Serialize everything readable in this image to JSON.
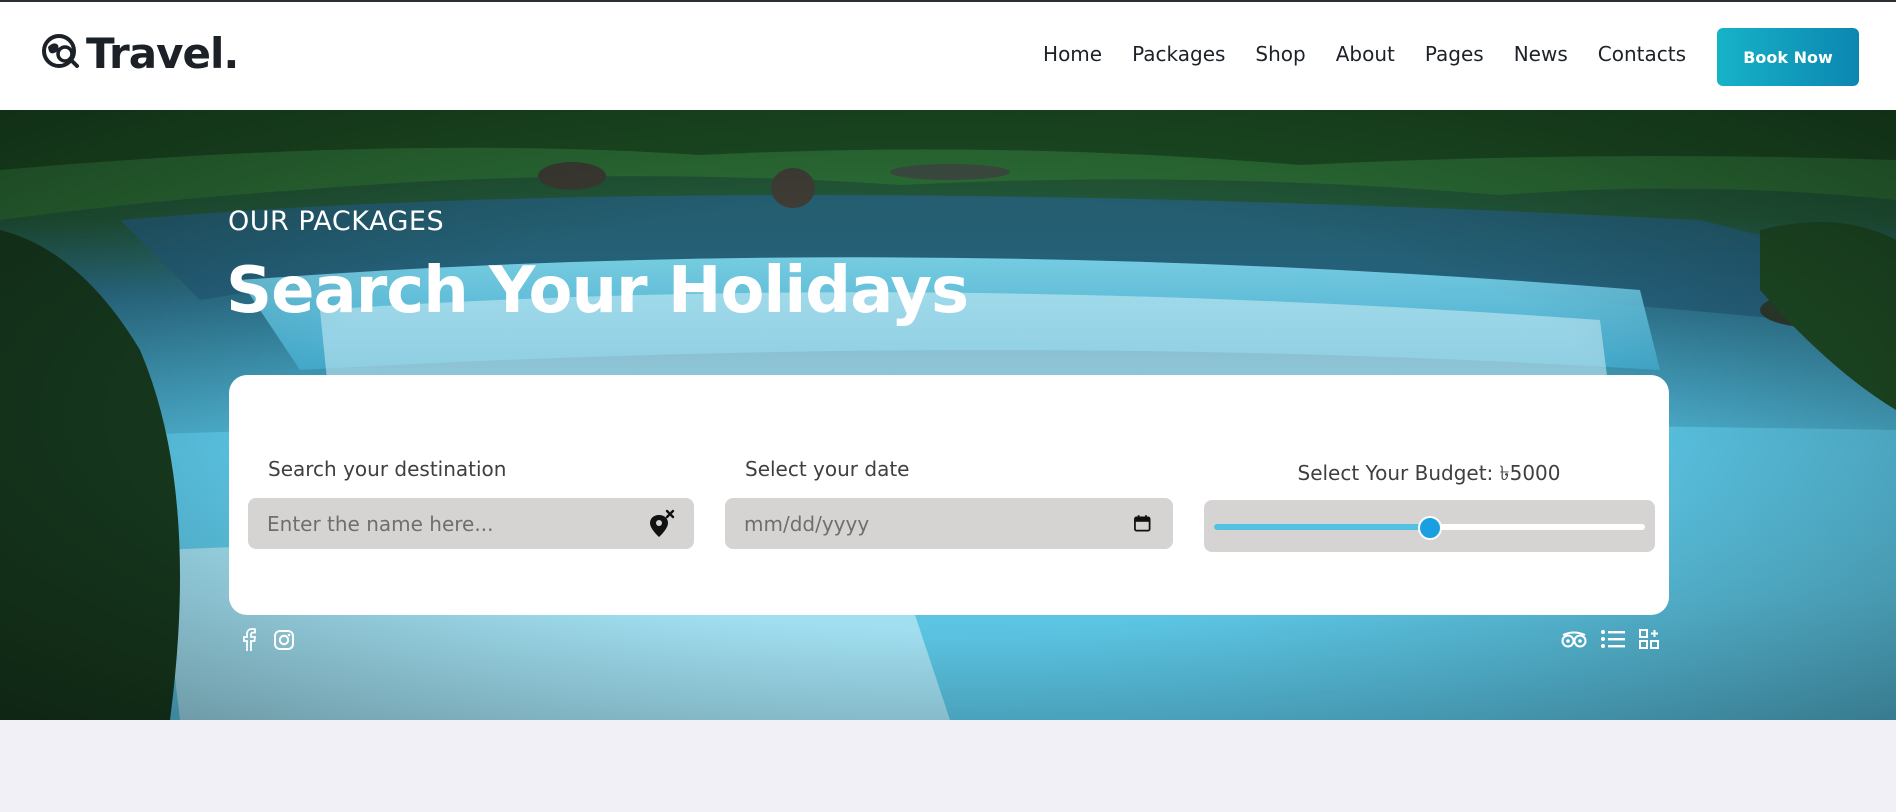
{
  "brand": {
    "name": "Travel."
  },
  "nav": {
    "items": [
      "Home",
      "Packages",
      "Shop",
      "About",
      "Pages",
      "News",
      "Contacts"
    ],
    "cta_label": "Book Now"
  },
  "hero": {
    "subtitle": "OUR PACKAGES",
    "title": "Search Your Holidays"
  },
  "search": {
    "destination": {
      "label": "Search your destination",
      "placeholder": "Enter the name here..."
    },
    "date": {
      "label": "Select your date",
      "placeholder": "mm/dd/yyyy"
    },
    "budget": {
      "label": "Select Your Budget: ৳5000",
      "value_fraction": 0.5
    }
  },
  "icons": {
    "left": [
      "facebook-icon",
      "instagram-icon"
    ],
    "right": [
      "tripadvisor-icon",
      "list-icon",
      "grid-icon"
    ]
  },
  "colors": {
    "accent": "#13a9c6",
    "slider_fill": "#53c1e2",
    "slider_thumb": "#1aa0e0",
    "page_bg": "#f0f0f6"
  }
}
